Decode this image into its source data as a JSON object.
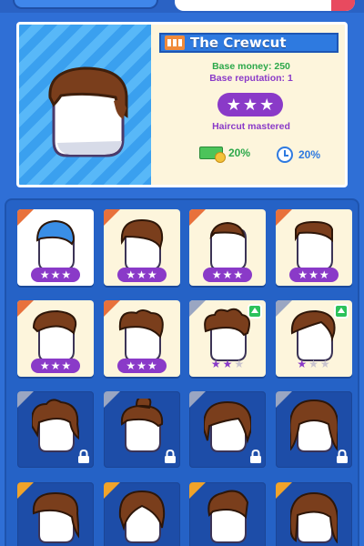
{
  "detail": {
    "title": "The Crewcut",
    "base_money": "Base money: 250",
    "base_reputation": "Base reputation: 1",
    "stars": 3,
    "status": "Haircut mastered",
    "money_bonus": "20%",
    "time_bonus": "20%"
  },
  "grid": [
    {
      "hair": "crewcut",
      "state": "selected",
      "stars": 3
    },
    {
      "hair": "short",
      "state": "unlocked",
      "stars": 3
    },
    {
      "hair": "buzz",
      "state": "unlocked",
      "stars": 3
    },
    {
      "hair": "flat",
      "state": "unlocked",
      "stars": 3
    },
    {
      "hair": "swept",
      "state": "unlocked",
      "stars": 3
    },
    {
      "hair": "wavy",
      "state": "unlocked",
      "stars": 3
    },
    {
      "hair": "curly",
      "state": "upgradable",
      "stars": 2
    },
    {
      "hair": "sidepart",
      "state": "upgradable",
      "stars": 1
    },
    {
      "hair": "messy",
      "state": "locked"
    },
    {
      "hair": "bun",
      "state": "locked"
    },
    {
      "hair": "shaggy",
      "state": "locked"
    },
    {
      "hair": "long",
      "state": "locked"
    },
    {
      "hair": "mullet",
      "state": "locked"
    },
    {
      "hair": "bob",
      "state": "locked"
    },
    {
      "hair": "quiff",
      "state": "locked"
    },
    {
      "hair": "dreads",
      "state": "locked"
    }
  ],
  "colors": {
    "background": "#2f6fd6",
    "panel": "#2562c6",
    "card": "#fdf5dc",
    "purple": "#8a3ac8",
    "green": "#2ca84a",
    "hair_brown": "#7a3e1c",
    "hair_blue": "#3a8ee6"
  }
}
